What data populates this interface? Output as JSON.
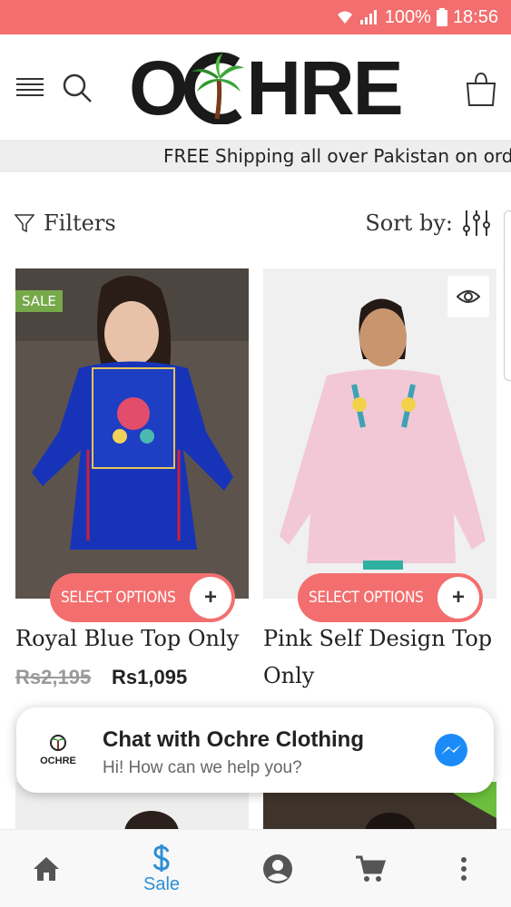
{
  "status_bar": {
    "battery": "100%",
    "time": "18:56"
  },
  "header": {
    "logo_text_left": "O",
    "logo_text_right": "HRE",
    "logo_alt": "OCHRE"
  },
  "announcement": "FREE Shipping all over Pakistan on orders a",
  "filters_label": "Filters",
  "sort_label": "Sort by:",
  "products": [
    {
      "badge": "SALE",
      "select_label": "SELECT OPTIONS",
      "name": "Royal Blue Top Only",
      "price_old": "Rs2,195",
      "price_new": "Rs1,095"
    },
    {
      "badge": "",
      "select_label": "SELECT OPTIONS",
      "name": "Pink Self Design Top Only",
      "price_old": "",
      "price_new": ""
    }
  ],
  "chat": {
    "title": "Chat with Ochre Clothing",
    "subtitle": "Hi! How can we help you?",
    "avatar_text": "OCHRE"
  },
  "bottom_nav": {
    "sale_label": "Sale"
  },
  "colors": {
    "accent": "#f36f6f",
    "sale_badge": "#75a94a",
    "nav_active": "#2d8fd5",
    "messenger": "#1b8cf7"
  }
}
